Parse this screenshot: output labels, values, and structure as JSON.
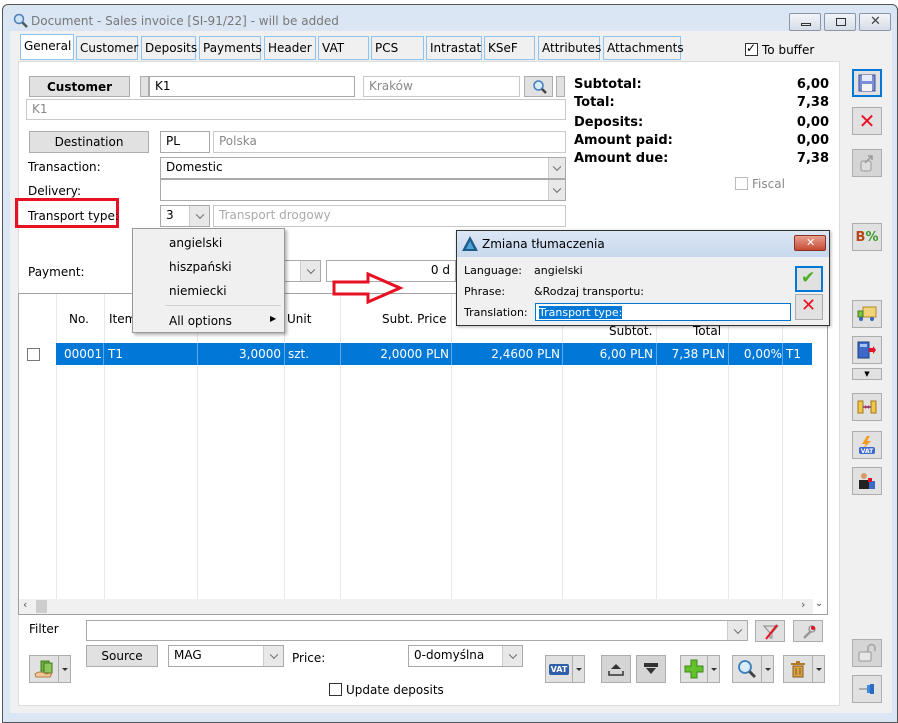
{
  "window": {
    "title": "Document - Sales invoice [SI-91/22]  - will be added"
  },
  "tabs": [
    {
      "label": "General",
      "active": true
    },
    {
      "label": "Customer"
    },
    {
      "label": "Deposits"
    },
    {
      "label": "Payments"
    },
    {
      "label": "Header"
    },
    {
      "label": "VAT"
    },
    {
      "label": "PCS"
    },
    {
      "label": "Intrastat"
    },
    {
      "label": "KSeF"
    },
    {
      "label": "Attributes"
    },
    {
      "label": "Attachments"
    }
  ],
  "to_buffer": {
    "label": "To buffer",
    "checked": true
  },
  "form": {
    "customer_button": "Customer",
    "customer_code": "K1",
    "customer_city": "Kraków",
    "customer_name": "K1",
    "destination_button": "Destination",
    "destination_code": "PL",
    "destination_name": "Polska",
    "transaction_label": "Transaction:",
    "transaction_value": "Domestic",
    "delivery_label": "Delivery:",
    "delivery_value": "",
    "transport_label": "Transport type:",
    "transport_code": "3",
    "transport_name": "Transport drogowy",
    "payment_label": "Payment:",
    "payment_days": "0 d"
  },
  "summary": {
    "items": [
      {
        "label": "Subtotal:",
        "value": "6,00"
      },
      {
        "label": "Total:",
        "value": "7,38"
      },
      {
        "label": "Deposits:",
        "value": "0,00"
      },
      {
        "label": "Amount paid:",
        "value": "0,00"
      },
      {
        "label": "Amount due:",
        "value": "7,38"
      }
    ],
    "fiscal_label": "Fiscal",
    "fiscal_checked": false
  },
  "context_menu": {
    "items": [
      "angielski",
      "hiszpański",
      "niemiecki"
    ],
    "all_options": "All options"
  },
  "dialog": {
    "title": "Zmiana tłumaczenia",
    "language_label": "Language:",
    "language_value": "angielski",
    "phrase_label": "Phrase:",
    "phrase_value": "&Rodzaj transportu:",
    "translation_label": "Translation:",
    "translation_value": "Transport type:"
  },
  "grid": {
    "headers": {
      "no": "No.",
      "item": "Item",
      "unit": "Unit",
      "subt_price": "Subt. Price",
      "subtot": "Subtot.",
      "total": "Total"
    },
    "rows": [
      {
        "no": "00001",
        "item": "T1",
        "quantity": "3,0000",
        "unit": "szt.",
        "subt_price": "2,0000 PLN",
        "price": "2,4600 PLN",
        "subtot": "6,00 PLN",
        "total": "7,38 PLN",
        "discount": "0,00%",
        "code": "T1",
        "checked": false
      }
    ]
  },
  "bottom": {
    "filter_label": "Filter",
    "filter_value": "",
    "source_button": "Source",
    "source_value": "MAG",
    "price_label": "Price:",
    "price_value": "0-domyślna",
    "update_deposits_label": "Update deposits",
    "update_deposits_checked": false,
    "vat_label": "VAT"
  },
  "colors": {
    "accent": "#0078d7",
    "highlight_red": "#e81123",
    "tab_border": "#8ec3ef"
  }
}
